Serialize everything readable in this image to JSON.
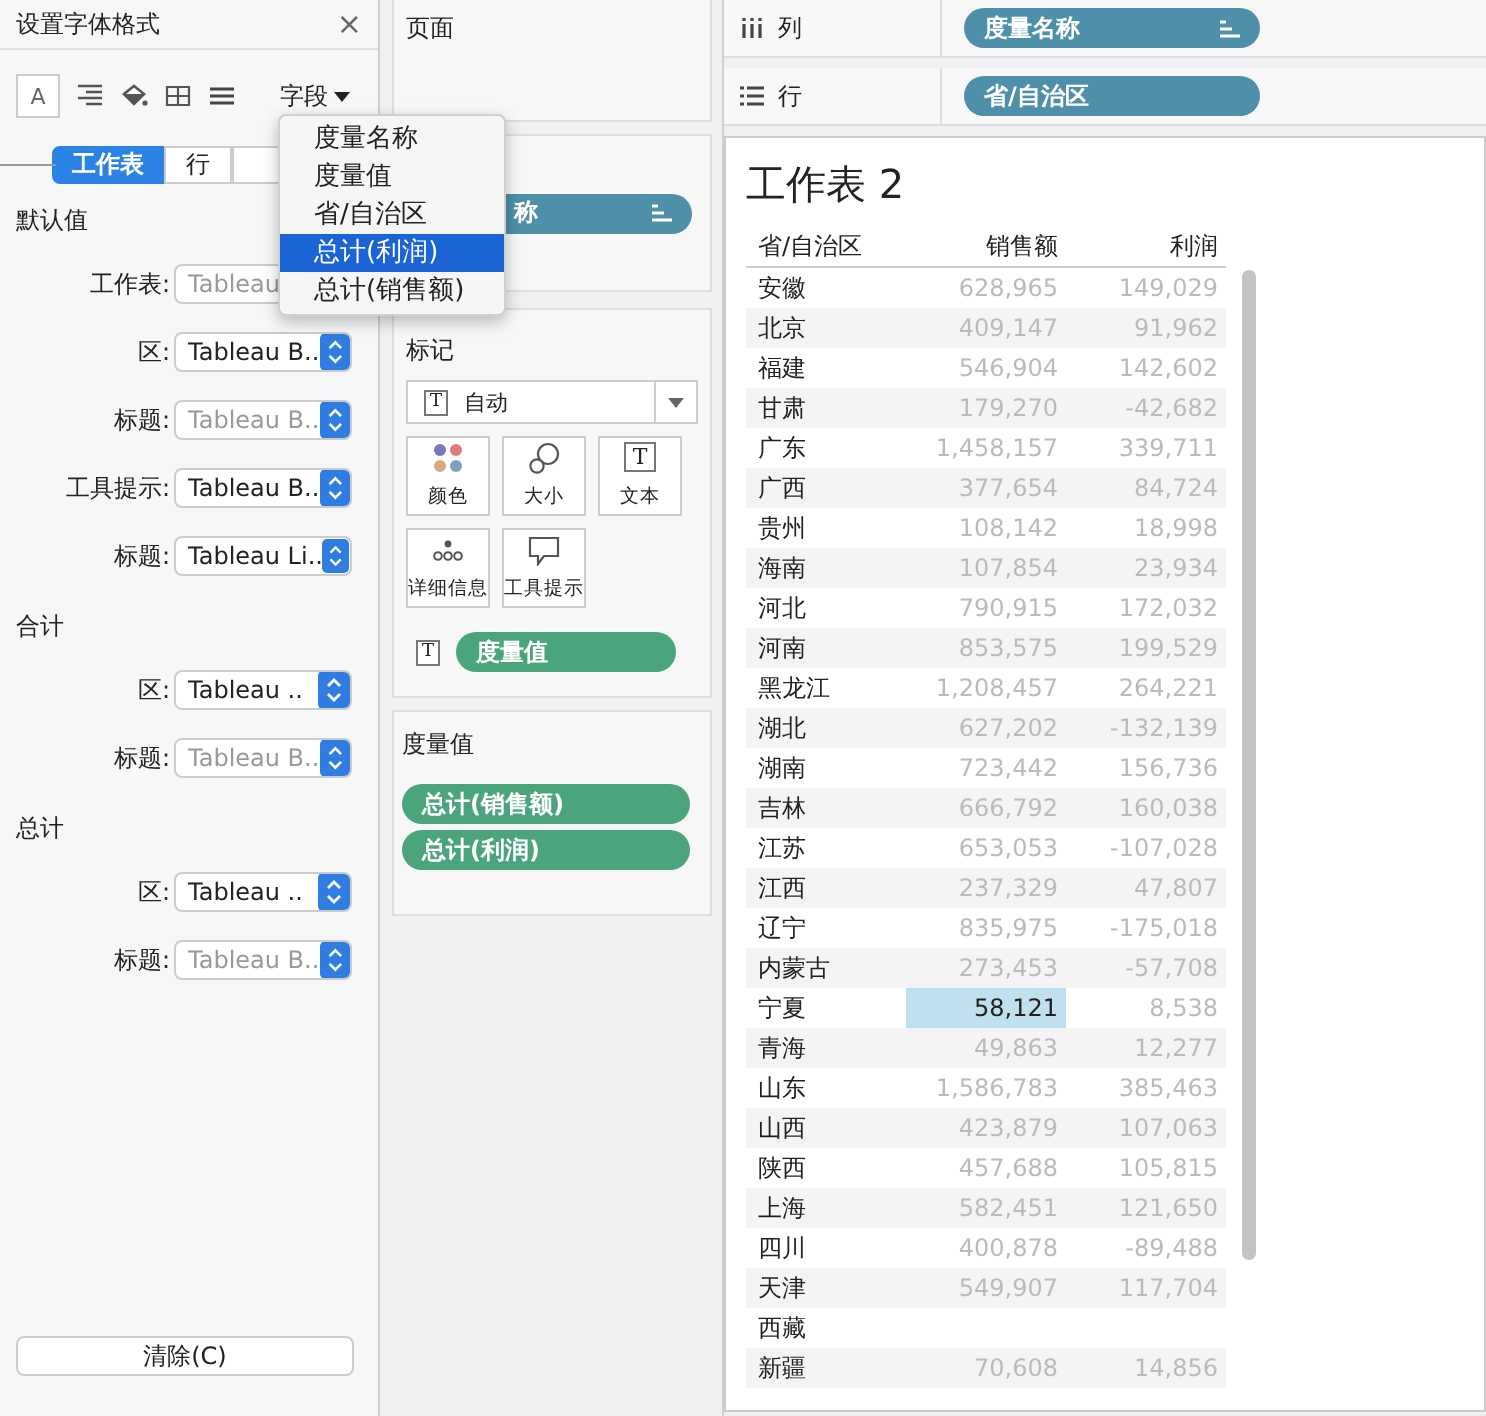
{
  "format_panel": {
    "title": "设置字体格式",
    "close": "×",
    "font_icon": "A",
    "field_button": "字段",
    "tabs": [
      {
        "label": "工作表",
        "selected": true
      },
      {
        "label": "行",
        "selected": false
      },
      {
        "selected": false
      }
    ],
    "sections": [
      {
        "title": "默认值",
        "rows": [
          {
            "label": "工作表:",
            "value": "Tableau",
            "inherited": true,
            "stepper": false
          },
          {
            "label": "区:",
            "value": "Tableau B..",
            "inherited": false,
            "stepper": true
          },
          {
            "label": "标题:",
            "value": "Tableau B..",
            "inherited": true,
            "stepper": true
          },
          {
            "label": "工具提示:",
            "value": "Tableau B..",
            "inherited": false,
            "stepper": true
          },
          {
            "label": "标题:",
            "value": "Tableau Li..",
            "inherited": false,
            "stepper": true
          }
        ]
      },
      {
        "title": "合计",
        "rows": [
          {
            "label": "区:",
            "value": "Tableau ..",
            "inherited": false,
            "stepper": true
          },
          {
            "label": "标题:",
            "value": "Tableau B..",
            "inherited": true,
            "stepper": true
          }
        ]
      },
      {
        "title": "总计",
        "rows": [
          {
            "label": "区:",
            "value": "Tableau ..",
            "inherited": false,
            "stepper": true
          },
          {
            "label": "标题:",
            "value": "Tableau B..",
            "inherited": true,
            "stepper": true
          }
        ]
      }
    ],
    "clear_button": "清除(C)"
  },
  "field_menu": {
    "items": [
      {
        "label": "度量名称",
        "selected": false
      },
      {
        "label": "度量值",
        "selected": false
      },
      {
        "label": "省/自治区",
        "selected": false
      },
      {
        "label": "总计(利润)",
        "selected": true
      },
      {
        "label": "总计(销售额)",
        "selected": false
      }
    ]
  },
  "pages_shelf": {
    "title": "页面"
  },
  "filters_shelf": {
    "pill": "称"
  },
  "marks": {
    "title": "标记",
    "type_icon": "T",
    "type": "自动",
    "buttons": [
      {
        "kind": "color",
        "label": "颜色"
      },
      {
        "kind": "size",
        "label": "大小"
      },
      {
        "kind": "text",
        "label": "文本",
        "icon": "T"
      },
      {
        "kind": "detail",
        "label": "详细信息"
      },
      {
        "kind": "tooltip",
        "label": "工具提示"
      }
    ],
    "pills": [
      {
        "icon": "T",
        "label": "度量值"
      }
    ]
  },
  "measure_values": {
    "title": "度量值",
    "pills": [
      "总计(销售额)",
      "总计(利润)"
    ]
  },
  "columns_shelf": {
    "label": "列",
    "pill": "度量名称"
  },
  "rows_shelf": {
    "label": "行",
    "pill": "省/自治区"
  },
  "sheet": {
    "title": "工作表 2",
    "columns": [
      "省/自治区",
      "销售额",
      "利润"
    ],
    "rows": [
      {
        "region": "安徽",
        "sales": "628,965",
        "profit": "149,029",
        "selected": false
      },
      {
        "region": "北京",
        "sales": "409,147",
        "profit": "91,962",
        "selected": false
      },
      {
        "region": "福建",
        "sales": "546,904",
        "profit": "142,602",
        "selected": false
      },
      {
        "region": "甘肃",
        "sales": "179,270",
        "profit": "-42,682",
        "selected": false
      },
      {
        "region": "广东",
        "sales": "1,458,157",
        "profit": "339,711",
        "selected": false
      },
      {
        "region": "广西",
        "sales": "377,654",
        "profit": "84,724",
        "selected": false
      },
      {
        "region": "贵州",
        "sales": "108,142",
        "profit": "18,998",
        "selected": false
      },
      {
        "region": "海南",
        "sales": "107,854",
        "profit": "23,934",
        "selected": false
      },
      {
        "region": "河北",
        "sales": "790,915",
        "profit": "172,032",
        "selected": false
      },
      {
        "region": "河南",
        "sales": "853,575",
        "profit": "199,529",
        "selected": false
      },
      {
        "region": "黑龙江",
        "sales": "1,208,457",
        "profit": "264,221",
        "selected": false
      },
      {
        "region": "湖北",
        "sales": "627,202",
        "profit": "-132,139",
        "selected": false
      },
      {
        "region": "湖南",
        "sales": "723,442",
        "profit": "156,736",
        "selected": false
      },
      {
        "region": "吉林",
        "sales": "666,792",
        "profit": "160,038",
        "selected": false
      },
      {
        "region": "江苏",
        "sales": "653,053",
        "profit": "-107,028",
        "selected": false
      },
      {
        "region": "江西",
        "sales": "237,329",
        "profit": "47,807",
        "selected": false
      },
      {
        "region": "辽宁",
        "sales": "835,975",
        "profit": "-175,018",
        "selected": false
      },
      {
        "region": "内蒙古",
        "sales": "273,453",
        "profit": "-57,708",
        "selected": false
      },
      {
        "region": "宁夏",
        "sales": "58,121",
        "profit": "8,538",
        "selected": true
      },
      {
        "region": "青海",
        "sales": "49,863",
        "profit": "12,277",
        "selected": false
      },
      {
        "region": "山东",
        "sales": "1,586,783",
        "profit": "385,463",
        "selected": false
      },
      {
        "region": "山西",
        "sales": "423,879",
        "profit": "107,063",
        "selected": false
      },
      {
        "region": "陕西",
        "sales": "457,688",
        "profit": "105,815",
        "selected": false
      },
      {
        "region": "上海",
        "sales": "582,451",
        "profit": "121,650",
        "selected": false
      },
      {
        "region": "四川",
        "sales": "400,878",
        "profit": "-89,488",
        "selected": false
      },
      {
        "region": "天津",
        "sales": "549,907",
        "profit": "117,704",
        "selected": false
      },
      {
        "region": "西藏",
        "selected": false
      },
      {
        "region": "新疆",
        "sales": "70,608",
        "profit": "14,856",
        "selected": false
      }
    ]
  }
}
